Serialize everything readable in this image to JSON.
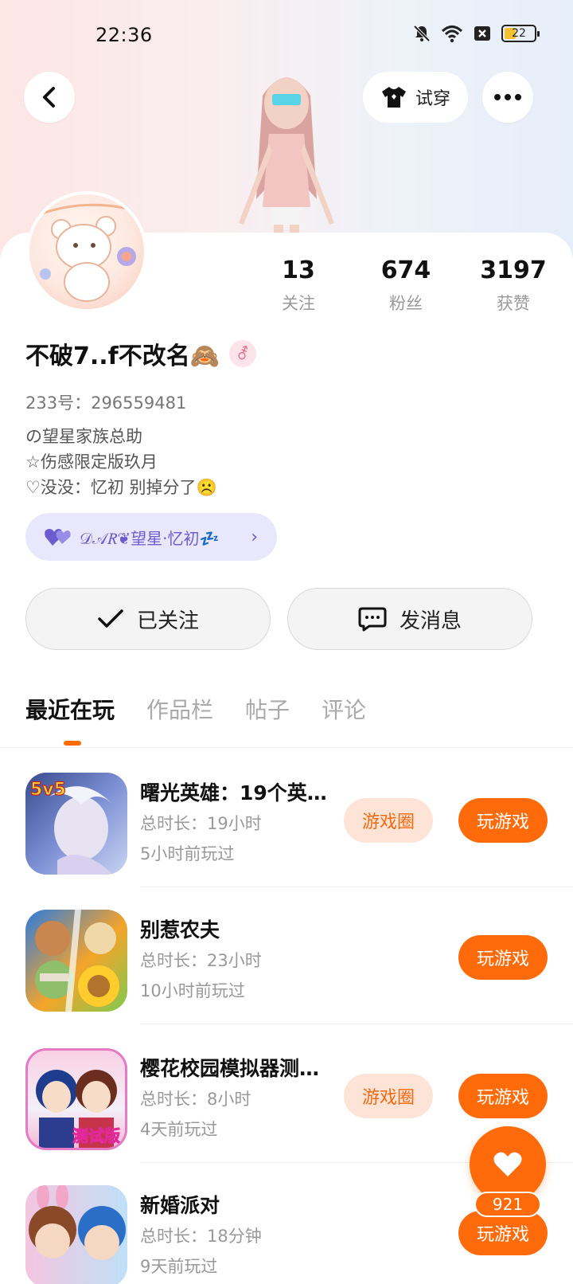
{
  "status_bar": {
    "time": "22:36",
    "battery": "22"
  },
  "header": {
    "try_on_label": "试穿"
  },
  "stats": [
    {
      "value": "13",
      "label": "关注"
    },
    {
      "value": "674",
      "label": "粉丝"
    },
    {
      "value": "3197",
      "label": "获赞"
    }
  ],
  "profile": {
    "name": "不破7..f不改名🙈",
    "gender_symbol": "⚦",
    "uid": "233号：296559481",
    "bio": [
      "の望星家族总助",
      "☆伤感限定版玖月",
      "♡没没：忆初 别掉分了☹️"
    ],
    "family_tag": "𝒟𝒜𝑅❦望星·忆初💤"
  },
  "actions": {
    "follow_label": "已关注",
    "message_label": "发消息"
  },
  "tabs": [
    {
      "label": "最近在玩",
      "active": true
    },
    {
      "label": "作品栏",
      "active": false
    },
    {
      "label": "帖子",
      "active": false
    },
    {
      "label": "评论",
      "active": false
    }
  ],
  "games": [
    {
      "title": "曙光英雄：19个英…",
      "duration": "总时长：19小时",
      "last_played": "5小时前玩过",
      "has_circle": true,
      "circle_label": "游戏圈",
      "play_label": "玩游戏",
      "badge": "5v5"
    },
    {
      "title": "别惹农夫",
      "duration": "总时长：23小时",
      "last_played": "10小时前玩过",
      "has_circle": false,
      "play_label": "玩游戏"
    },
    {
      "title": "樱花校园模拟器测…",
      "duration": "总时长：8小时",
      "last_played": "4天前玩过",
      "has_circle": true,
      "circle_label": "游戏圈",
      "play_label": "玩游戏",
      "badge": "测试版"
    },
    {
      "title": "新婚派对",
      "duration": "总时长：18分钟",
      "last_played": "9天前玩过",
      "has_circle": false,
      "play_label": "玩游戏"
    }
  ],
  "like_fab": {
    "count": "921"
  },
  "colors": {
    "accent": "#ff6b0a",
    "circle_bg": "#fde4d6",
    "family_bg": "#e8e7fb",
    "family_text": "#6d5bd0"
  }
}
